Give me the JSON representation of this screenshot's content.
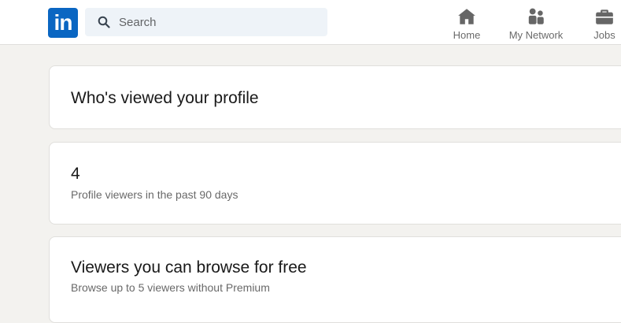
{
  "header": {
    "logo_text": "in",
    "search": {
      "placeholder": "Search",
      "value": ""
    },
    "nav": [
      {
        "label": "Home",
        "icon": "home-icon"
      },
      {
        "label": "My Network",
        "icon": "people-icon"
      },
      {
        "label": "Jobs",
        "icon": "briefcase-icon"
      }
    ]
  },
  "main": {
    "page_title": "Who's viewed your profile",
    "viewer_count": {
      "value": "4",
      "caption": "Profile viewers in the past 90 days"
    },
    "free_viewers": {
      "title": "Viewers you can browse for free",
      "caption": "Browse up to 5 viewers without Premium"
    }
  },
  "colors": {
    "brand": "#0a66c2",
    "background": "#f3f2ef",
    "search_bg": "#eef3f8",
    "card_border": "#e0dfdc"
  }
}
